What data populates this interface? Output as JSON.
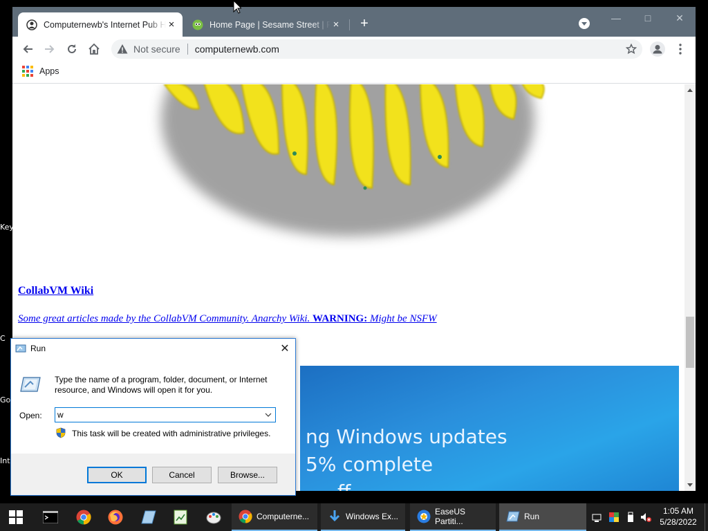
{
  "desktop": {
    "fragments": [
      "Key",
      "C",
      "Go",
      "Int"
    ]
  },
  "browser": {
    "tabs": [
      {
        "title": "Computernewb's Internet Pub Hub",
        "active": true
      },
      {
        "title": "Home Page | Sesame Street | PBS KIDS",
        "active": false
      }
    ],
    "new_tab_label": "+",
    "omnibox": {
      "security_label": "Not secure",
      "url": "computernewb.com"
    },
    "bookmarks": {
      "apps_label": "Apps"
    }
  },
  "page": {
    "wiki_title": "CollabVM Wiki",
    "wiki_desc": "Some great articles made by the CollabVM Community. Anarchy Wiki.",
    "warning_label": "WARNING:",
    "warning_text": "Might be NSFW",
    "update_lines": [
      "ng Windows updates",
      "5% complete",
      "ff"
    ]
  },
  "run_dialog": {
    "title": "Run",
    "description": "Type the name of a program, folder, document, or Internet resource, and Windows will open it for you.",
    "open_label": "Open:",
    "open_value": "w",
    "admin_note": "This task will be created with administrative privileges.",
    "ok_label": "OK",
    "cancel_label": "Cancel",
    "browse_label": "Browse..."
  },
  "taskbar": {
    "apps": [
      {
        "label": "Computerne...",
        "icon": "chrome-icon"
      },
      {
        "label": "Windows Ex...",
        "icon": "download-icon"
      },
      {
        "label": "EaseUS Partiti...",
        "icon": "easeus-icon"
      },
      {
        "label": "Run",
        "icon": "run-icon",
        "active": true
      }
    ],
    "clock_time": "1:05 AM",
    "clock_date": "5/28/2022"
  },
  "colors": {
    "chrome_frame": "#5f6d7a",
    "link": "#0000ee",
    "win_accent": "#0078d7",
    "update_bg": "#1f86d4"
  }
}
